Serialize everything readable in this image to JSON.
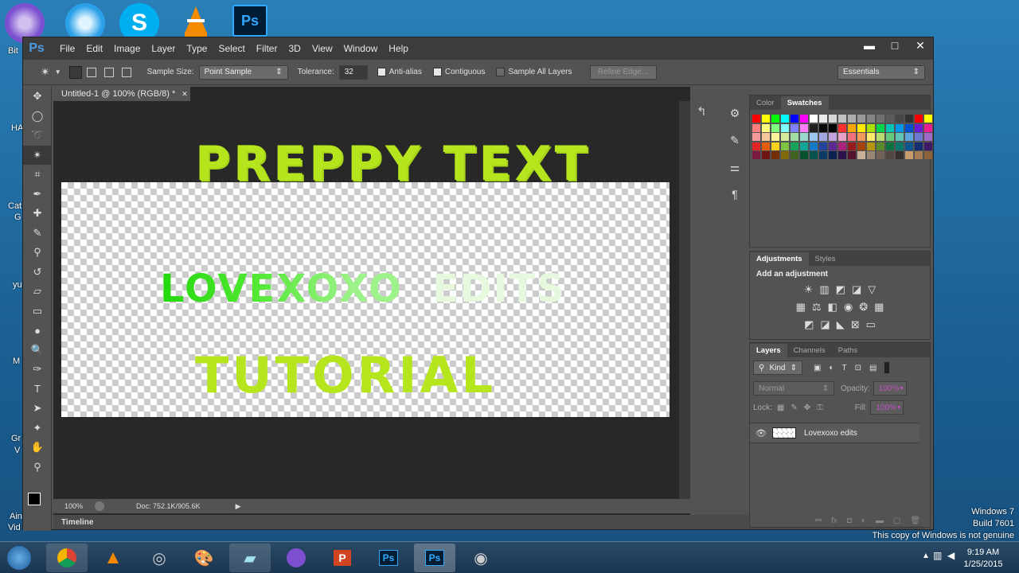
{
  "desktop": {
    "labels": [
      "Bit",
      "HA",
      "Cat",
      "G",
      "yu",
      "M",
      "Gr",
      "V",
      "Ain",
      "Vid"
    ],
    "watermark": [
      "Windows 7",
      "Build 7601",
      "This copy of Windows is not genuine"
    ]
  },
  "ps": {
    "logo": "Ps",
    "menu": [
      "File",
      "Edit",
      "Image",
      "Layer",
      "Type",
      "Select",
      "Filter",
      "3D",
      "View",
      "Window",
      "Help"
    ],
    "options": {
      "sample_size_label": "Sample Size:",
      "sample_size_value": "Point Sample",
      "tolerance_label": "Tolerance:",
      "tolerance_value": "32",
      "antialias": "Anti-alias",
      "contiguous": "Contiguous",
      "sample_all": "Sample All Layers",
      "refine": "Refine Edge...",
      "workspace": "Essentials"
    },
    "doc_tab": "Untitled-1 @ 100% (RGB/8) *",
    "canvas_text": {
      "line1": "PREPPY TEXT",
      "line2a": "LOVEXOXO",
      "line2b": "EDITS",
      "line3": "TUTORIAL"
    },
    "status": {
      "zoom": "100%",
      "doc": "Doc: 752.1K/905.6K"
    },
    "timeline": "Timeline",
    "swatches_panel": {
      "tabs": [
        "Color",
        "Swatches"
      ]
    },
    "adjust_panel": {
      "tabs": [
        "Adjustments",
        "Styles"
      ],
      "heading": "Add an adjustment"
    },
    "layers_panel": {
      "tabs": [
        "Layers",
        "Channels",
        "Paths"
      ],
      "kind": "Kind",
      "blend": "Normal",
      "opacity_label": "Opacity:",
      "opacity": "100%",
      "lock_label": "Lock:",
      "fill_label": "Fill:",
      "fill": "100%",
      "layer_name": "Lovexoxo edits"
    },
    "colors": {
      "text_line1": "#b5e61d",
      "text_line3": "#b5e61d",
      "accent": "#4a9be0"
    }
  },
  "taskbar": {
    "time": "9:19 AM",
    "date": "1/25/2015"
  },
  "swatches": [
    "#ff0000",
    "#ffff00",
    "#00ff00",
    "#00ffff",
    "#0000ff",
    "#ff00ff",
    "#ffffff",
    "#ebebeb",
    "#d6d6d6",
    "#c2c2c2",
    "#adadad",
    "#999999",
    "#858585",
    "#707070",
    "#5c5c5c",
    "#474747",
    "#333333",
    "#ff0000",
    "#ffff00",
    "#ff7f7f",
    "#ffff7f",
    "#7fff7f",
    "#7fffff",
    "#7f7fff",
    "#ff7fff",
    "#1f1f1f",
    "#0a0a0a",
    "#000000",
    "#ff3030",
    "#f7a700",
    "#ffea00",
    "#a8e000",
    "#00d54b",
    "#00c4b6",
    "#0095e6",
    "#0050d0",
    "#6a1bd6",
    "#ea1e8c",
    "#f49a9a",
    "#f6c79a",
    "#fbf29b",
    "#d4ea9b",
    "#a0dba0",
    "#9ad8cf",
    "#9bc7ec",
    "#a1a5e0",
    "#c2a0dc",
    "#e9a1ca",
    "#f2707a",
    "#f59a5e",
    "#f9ea6c",
    "#b9dc6e",
    "#66c97c",
    "#5dc4b6",
    "#5ea6e0",
    "#6c79cf",
    "#9e6bc7",
    "#e02627",
    "#e45d0e",
    "#f7d11c",
    "#7fc341",
    "#16a35c",
    "#13a597",
    "#1679c5",
    "#24449c",
    "#5c2892",
    "#a9237d",
    "#9a1b1e",
    "#a34208",
    "#b8950f",
    "#5a8b2b",
    "#0c7240",
    "#0b756c",
    "#0e5690",
    "#162e6f",
    "#3f1a68",
    "#7a1a42",
    "#6e1415",
    "#722e05",
    "#826a0a",
    "#3f621e",
    "#07512c",
    "#06524c",
    "#093b65",
    "#0d1f4e",
    "#2b114a",
    "#55122e",
    "#c7b299",
    "#998675",
    "#736357",
    "#534741",
    "#37302d",
    "#c69c6d",
    "#a67c52",
    "#8c6239"
  ]
}
